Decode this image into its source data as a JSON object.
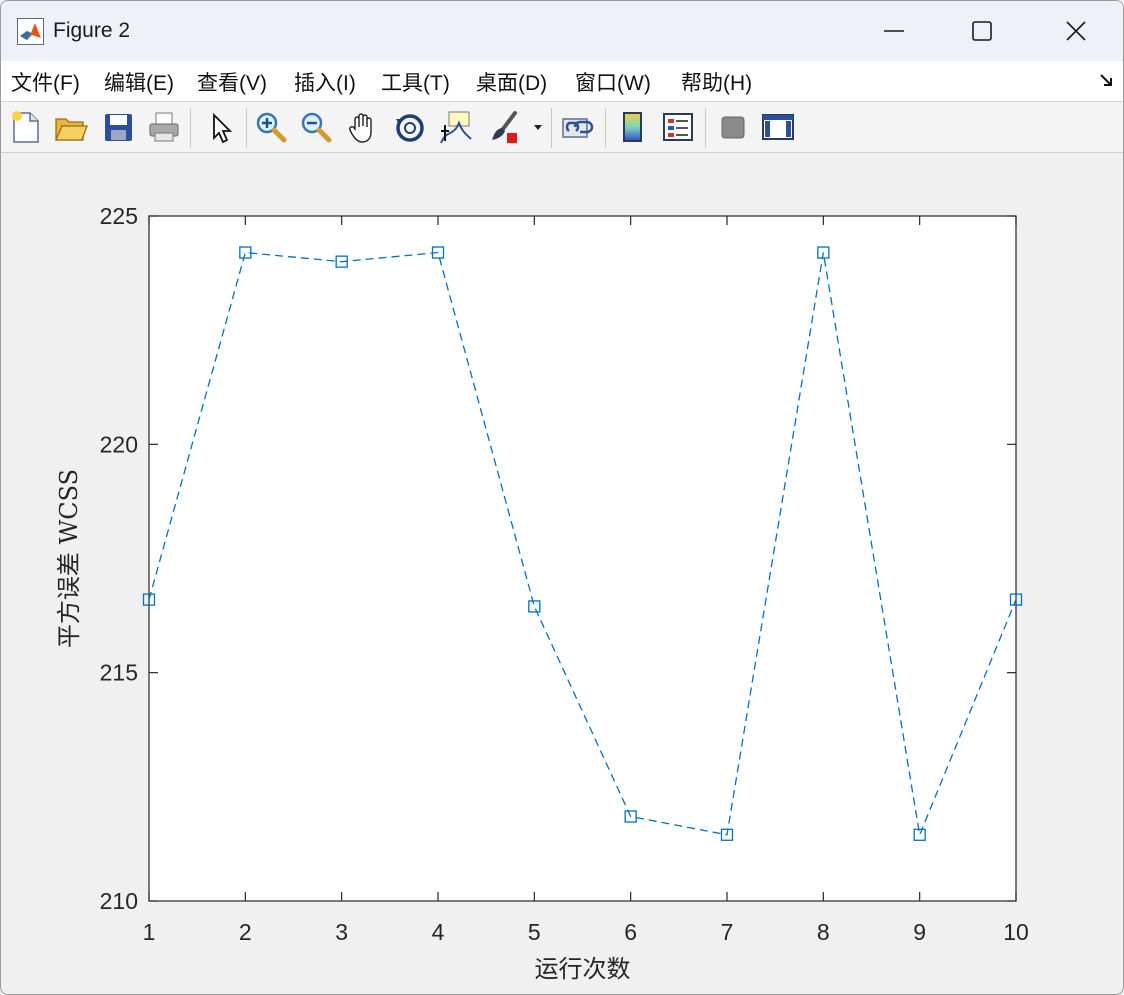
{
  "window": {
    "title": "Figure 2"
  },
  "menu": [
    "文件(F)",
    "编辑(E)",
    "查看(V)",
    "插入(I)",
    "工具(T)",
    "桌面(D)",
    "窗口(W)",
    "帮助(H)"
  ],
  "toolbar_icons": [
    "new-figure-icon",
    "open-file-icon",
    "save-icon",
    "print-icon",
    "pointer-icon",
    "zoom-in-icon",
    "zoom-out-icon",
    "pan-hand-icon",
    "rotate-3d-icon",
    "data-cursor-icon",
    "brush-icon",
    "brush-dropdown-icon",
    "link-plot-icon",
    "colorbar-icon",
    "legend-icon",
    "hide-plot-tools-icon",
    "show-plot-tools-icon"
  ],
  "chart_data": {
    "type": "line",
    "title": "",
    "xlabel": "运行次数",
    "ylabel": "平方误差 WCSS",
    "x": [
      1,
      2,
      3,
      4,
      5,
      6,
      7,
      8,
      9,
      10
    ],
    "y": [
      216.6,
      224.2,
      224.0,
      224.2,
      216.45,
      211.85,
      211.45,
      224.2,
      211.45,
      216.6
    ],
    "xlim": [
      1,
      10
    ],
    "ylim": [
      210,
      225
    ],
    "xticks": [
      "1",
      "2",
      "3",
      "4",
      "5",
      "6",
      "7",
      "8",
      "9",
      "10"
    ],
    "yticks": [
      "210",
      "215",
      "220",
      "225"
    ],
    "line_style": "dashed",
    "marker": "square",
    "color": "#0072bd",
    "grid": false
  }
}
